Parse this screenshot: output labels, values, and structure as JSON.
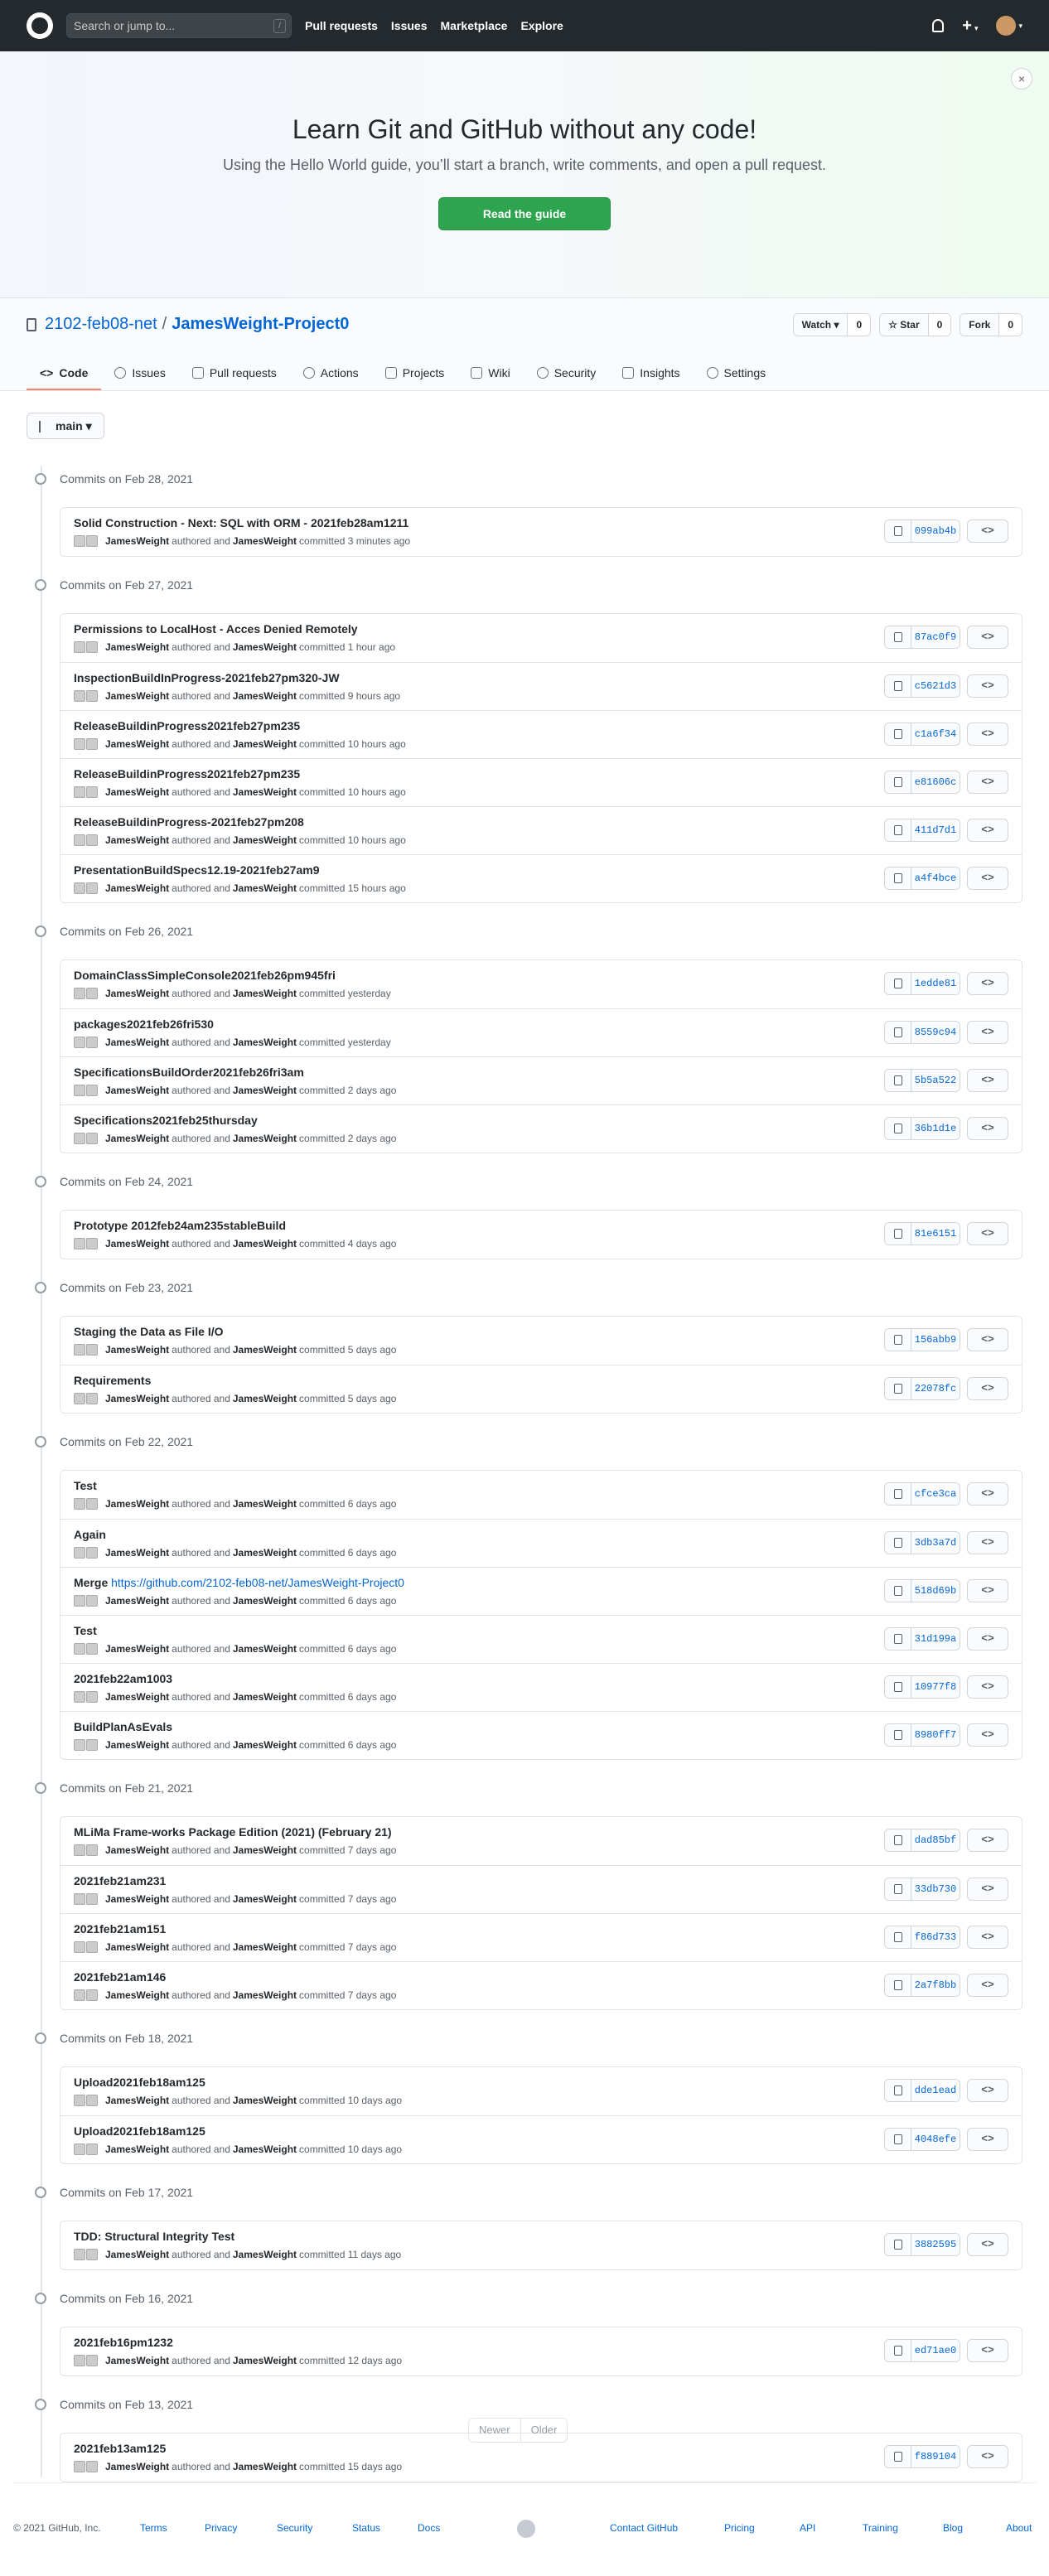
{
  "header": {
    "search_placeholder": "Search or jump to...",
    "slash": "/",
    "nav": [
      "Pull requests",
      "Issues",
      "Marketplace",
      "Explore"
    ],
    "plus": "+"
  },
  "banner": {
    "title": "Learn Git and GitHub without any code!",
    "subtitle": "Using the Hello World guide, you’ll start a branch, write comments, and open a pull request.",
    "button": "Read the guide",
    "close": "×"
  },
  "repo": {
    "owner": "2102-feb08-net",
    "sep": "/",
    "name": "JamesWeight-Project0",
    "watch_label": "Watch ▾",
    "watch_count": "0",
    "star_label": "☆ Star",
    "star_count": "0",
    "fork_label": "Fork",
    "fork_count": "0",
    "tabs": [
      "Code",
      "Issues",
      "Pull requests",
      "Actions",
      "Projects",
      "Wiki",
      "Security",
      "Insights",
      "Settings"
    ]
  },
  "branch": {
    "label": "main ▾"
  },
  "groups": [
    {
      "date": "Commits on Feb 28, 2021",
      "commits": [
        {
          "title": "Solid Construction - Next: SQL with ORM - 2021feb28am1211",
          "when": "committed 3 minutes ago",
          "sha": "099ab4b"
        }
      ]
    },
    {
      "date": "Commits on Feb 27, 2021",
      "commits": [
        {
          "title": "Permissions to LocalHost - Acces Denied Remotely",
          "when": "committed 1 hour ago",
          "sha": "87ac0f9"
        },
        {
          "title": "InspectionBuildInProgress-2021feb27pm320-JW",
          "when": "committed 9 hours ago",
          "sha": "c5621d3"
        },
        {
          "title": "ReleaseBuildinProgress2021feb27pm235",
          "when": "committed 10 hours ago",
          "sha": "c1a6f34"
        },
        {
          "title": "ReleaseBuildinProgress2021feb27pm235",
          "when": "committed 10 hours ago",
          "sha": "e81606c"
        },
        {
          "title": "ReleaseBuildinProgress-2021feb27pm208",
          "when": "committed 10 hours ago",
          "sha": "411d7d1"
        },
        {
          "title": "PresentationBuildSpecs12.19-2021feb27am9",
          "when": "committed 15 hours ago",
          "sha": "a4f4bce"
        }
      ]
    },
    {
      "date": "Commits on Feb 26, 2021",
      "commits": [
        {
          "title": "DomainClassSimpleConsole2021feb26pm945fri",
          "when": "committed yesterday",
          "sha": "1edde81"
        },
        {
          "title": "packages2021feb26fri530",
          "when": "committed yesterday",
          "sha": "8559c94"
        },
        {
          "title": "SpecificationsBuildOrder2021feb26fri3am",
          "when": "committed 2 days ago",
          "sha": "5b5a522"
        },
        {
          "title": "Specifications2021feb25thursday",
          "when": "committed 2 days ago",
          "sha": "36b1d1e"
        }
      ]
    },
    {
      "date": "Commits on Feb 24, 2021",
      "commits": [
        {
          "title": "Prototype 2012feb24am235stableBuild",
          "when": "committed 4 days ago",
          "sha": "81e6151"
        }
      ]
    },
    {
      "date": "Commits on Feb 23, 2021",
      "commits": [
        {
          "title": "Staging the Data as File I/O",
          "when": "committed 5 days ago",
          "sha": "156abb9"
        },
        {
          "title": "Requirements",
          "when": "committed 5 days ago",
          "sha": "22078fc"
        }
      ]
    },
    {
      "date": "Commits on Feb 22, 2021",
      "commits": [
        {
          "title": "Test",
          "when": "committed 6 days ago",
          "sha": "cfce3ca"
        },
        {
          "title": "Again",
          "when": "committed 6 days ago",
          "sha": "3db3a7d"
        },
        {
          "title": "Merge ",
          "link": "https://github.com/2102-feb08-net/JamesWeight-Project0",
          "when": "committed 6 days ago",
          "sha": "518d69b"
        },
        {
          "title": "Test",
          "when": "committed 6 days ago",
          "sha": "31d199a"
        },
        {
          "title": "2021feb22am1003",
          "when": "committed 6 days ago",
          "sha": "10977f8"
        },
        {
          "title": "BuildPlanAsEvals",
          "when": "committed 6 days ago",
          "sha": "8980ff7"
        }
      ]
    },
    {
      "date": "Commits on Feb 21, 2021",
      "commits": [
        {
          "title": "MLiMa Frame-works Package Edition (2021) (February 21)",
          "when": "committed 7 days ago",
          "sha": "dad85bf"
        },
        {
          "title": "2021feb21am231",
          "when": "committed 7 days ago",
          "sha": "33db730"
        },
        {
          "title": "2021feb21am151",
          "when": "committed 7 days ago",
          "sha": "f86d733"
        },
        {
          "title": "2021feb21am146",
          "when": "committed 7 days ago",
          "sha": "2a7f8bb"
        }
      ]
    },
    {
      "date": "Commits on Feb 18, 2021",
      "commits": [
        {
          "title": "Upload2021feb18am125",
          "when": "committed 10 days ago",
          "sha": "dde1ead"
        },
        {
          "title": "Upload2021feb18am125",
          "when": "committed 10 days ago",
          "sha": "4048efe"
        }
      ]
    },
    {
      "date": "Commits on Feb 17, 2021",
      "commits": [
        {
          "title": "TDD: Structural Integrity Test",
          "when": "committed 11 days ago",
          "sha": "3882595"
        }
      ]
    },
    {
      "date": "Commits on Feb 16, 2021",
      "commits": [
        {
          "title": "2021feb16pm1232",
          "when": "committed 12 days ago",
          "sha": "ed71ae0"
        }
      ]
    },
    {
      "date": "Commits on Feb 13, 2021",
      "commits": [
        {
          "title": "2021feb13am125",
          "when": "committed 15 days ago",
          "sha": "f889104"
        }
      ]
    }
  ],
  "author": "JamesWeight",
  "authored_and": "authored and",
  "browse_label": "<>",
  "pager": {
    "newer": "Newer",
    "older": "Older"
  },
  "footer": {
    "copyright": "© 2021 GitHub, Inc.",
    "links": [
      "Terms",
      "Privacy",
      "Security",
      "Status",
      "Docs",
      "Contact GitHub",
      "Pricing",
      "API",
      "Training",
      "Blog",
      "About"
    ]
  }
}
